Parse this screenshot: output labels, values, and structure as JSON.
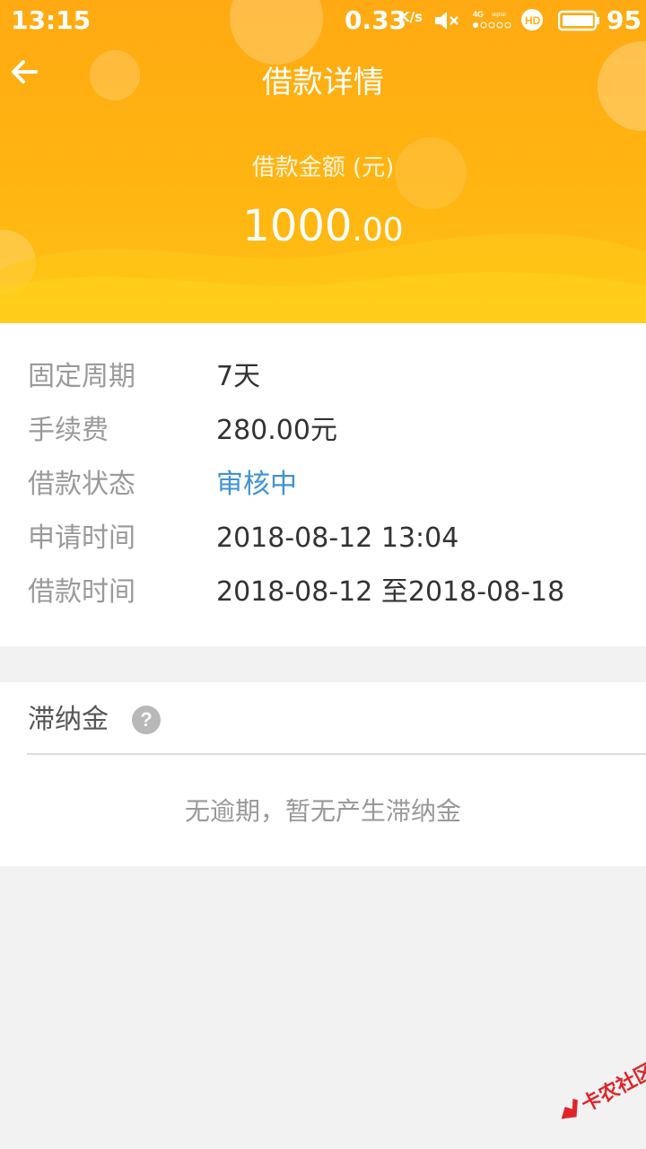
{
  "status_bar": {
    "time": "13:15",
    "net_speed": "0.33",
    "net_speed_unit": "K/s",
    "battery": "95",
    "icons": [
      "mute-icon",
      "signal-4g-icon",
      "hd-icon",
      "battery-icon"
    ]
  },
  "header": {
    "title": "借款详情",
    "amount_label": "借款金额 (元)",
    "amount_int": "1000",
    "amount_dec": ".00",
    "back_icon": "arrow-left-icon",
    "color": "#ffb114"
  },
  "details": [
    {
      "label": "固定周期",
      "value": "7天"
    },
    {
      "label": "手续费",
      "value": "280.00元"
    },
    {
      "label": "借款状态",
      "value": "审核中"
    },
    {
      "label": "申请时间",
      "value": "2018-08-12 13:04"
    },
    {
      "label": "借款时间",
      "value": "2018-08-12 至2018-08-18"
    }
  ],
  "status_color": "#3f93d3",
  "late_fee": {
    "title": "滞纳金",
    "help_icon": "question-icon",
    "empty_text": "无逾期，暂无产生滞纳金"
  },
  "watermark": {
    "text": "卡农社区"
  }
}
